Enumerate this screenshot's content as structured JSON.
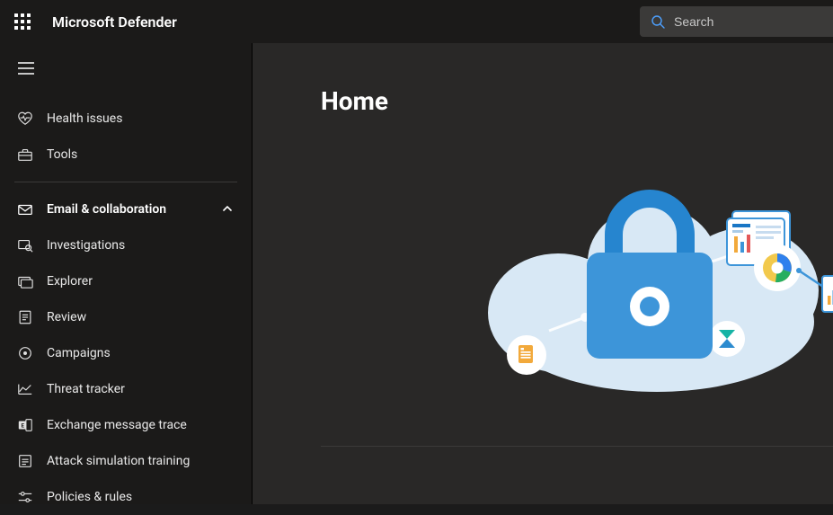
{
  "header": {
    "title": "Microsoft Defender",
    "search_placeholder": "Search"
  },
  "sidebar": {
    "top": [
      {
        "label": "Health issues",
        "icon": "heart"
      },
      {
        "label": "Tools",
        "icon": "toolbox"
      }
    ],
    "section": {
      "label": "Email & collaboration",
      "icon": "mail",
      "expanded": true,
      "items": [
        {
          "label": "Investigations",
          "icon": "investigation"
        },
        {
          "label": "Explorer",
          "icon": "explorer"
        },
        {
          "label": "Review",
          "icon": "review"
        },
        {
          "label": "Campaigns",
          "icon": "target"
        },
        {
          "label": "Threat tracker",
          "icon": "chart-line"
        },
        {
          "label": "Exchange message trace",
          "icon": "exchange"
        },
        {
          "label": "Attack simulation training",
          "icon": "attack-sim"
        },
        {
          "label": "Policies & rules",
          "icon": "sliders"
        }
      ]
    }
  },
  "main": {
    "page_title": "Home"
  }
}
